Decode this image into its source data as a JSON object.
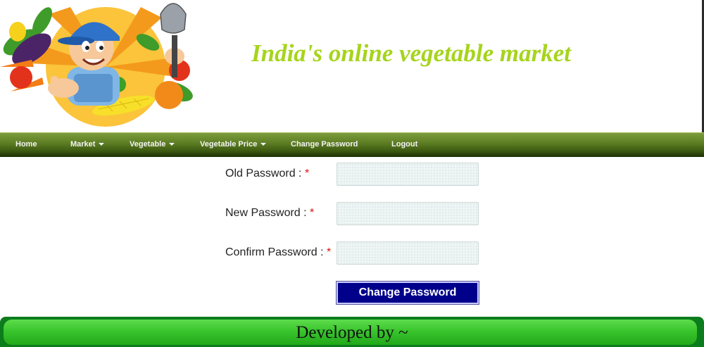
{
  "header": {
    "title": "India's online vegetable market",
    "title_color": "#a6d41c"
  },
  "nav": {
    "items": [
      {
        "label": "Home",
        "has_dropdown": false
      },
      {
        "label": "Market",
        "has_dropdown": true
      },
      {
        "label": "Vegetable",
        "has_dropdown": true
      },
      {
        "label": "Vegetable Price",
        "has_dropdown": true
      },
      {
        "label": "Change Password",
        "has_dropdown": false
      },
      {
        "label": "Logout",
        "has_dropdown": false
      }
    ]
  },
  "form": {
    "old_password_label": "Old Password : ",
    "new_password_label": "New Password : ",
    "confirm_password_label": "Confirm Password : ",
    "required_mark": "*",
    "old_password_value": "",
    "new_password_value": "",
    "confirm_password_value": "",
    "submit_label": "Change Password",
    "submit_color": "#00008b"
  },
  "footer": {
    "text": "Developed by ~",
    "color": "#22a81a"
  }
}
